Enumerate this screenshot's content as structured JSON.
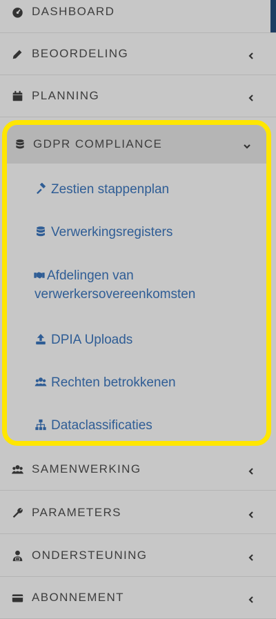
{
  "menu": {
    "dashboard": {
      "label": "DASHBOARD",
      "icon": "gauge-icon"
    },
    "beoordeling": {
      "label": "BEOORDELING",
      "icon": "pencil-icon"
    },
    "planning": {
      "label": "PLANNING",
      "icon": "calendar-icon"
    },
    "gdpr": {
      "label": "GDPR COMPLIANCE",
      "icon": "database-icon",
      "highlight_color": "#ffe600",
      "items": [
        {
          "label": "Zestien stappenplan",
          "icon": "gavel-icon"
        },
        {
          "label": "Verwerkingsregisters",
          "icon": "database-icon"
        },
        {
          "label": "Afdelingen van verwerkersovereenkomsten",
          "icon": "handshake-icon"
        },
        {
          "label": "DPIA Uploads",
          "icon": "upload-icon"
        },
        {
          "label": "Rechten betrokkenen",
          "icon": "users-icon"
        },
        {
          "label": "Dataclassificaties",
          "icon": "sitemap-icon"
        }
      ]
    },
    "samenwerking": {
      "label": "SAMENWERKING",
      "icon": "users-icon"
    },
    "parameters": {
      "label": "PARAMETERS",
      "icon": "wrench-icon"
    },
    "ondersteuning": {
      "label": "ONDERSTEUNING",
      "icon": "support-user-icon"
    },
    "abonnement": {
      "label": "ABONNEMENT",
      "icon": "credit-card-icon"
    }
  },
  "colors": {
    "sidebar_bg": "#c7c7c7",
    "active_bg": "#b5b5b5",
    "link": "#2f5d95",
    "accent": "#1f3d63"
  }
}
